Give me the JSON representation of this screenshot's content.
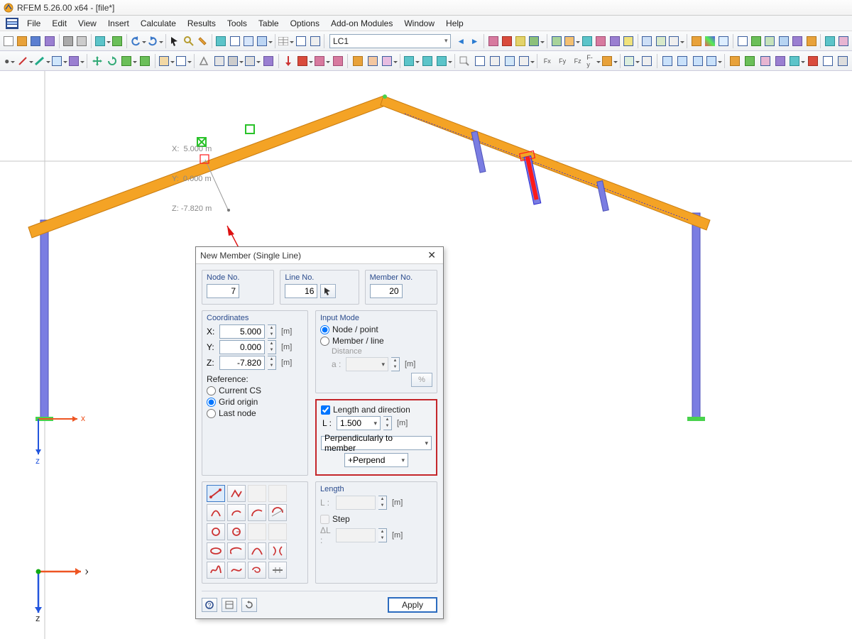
{
  "title": "RFEM 5.26.00 x64 - [file*]",
  "menus": [
    "File",
    "Edit",
    "View",
    "Insert",
    "Calculate",
    "Results",
    "Tools",
    "Table",
    "Options",
    "Add-on Modules",
    "Window",
    "Help"
  ],
  "lc_combo": "LC1",
  "cursor_readout": {
    "x": "X:  5.000 m",
    "y": "Y:  0.000 m",
    "z": "Z: -7.820 m"
  },
  "dialog": {
    "title": "New Member (Single Line)",
    "node_no_label": "Node No.",
    "node_no": "7",
    "line_no_label": "Line No.",
    "line_no": "16",
    "member_no_label": "Member No.",
    "member_no": "20",
    "coords_label": "Coordinates",
    "x_label": "X:",
    "x_val": "5.000",
    "x_unit": "[m]",
    "y_label": "Y:",
    "y_val": "0.000",
    "y_unit": "[m]",
    "z_label": "Z:",
    "z_val": "-7.820",
    "z_unit": "[m]",
    "reference_label": "Reference:",
    "ref_current": "Current CS",
    "ref_grid": "Grid origin",
    "ref_last": "Last node",
    "input_mode_label": "Input Mode",
    "im_node": "Node / point",
    "im_member": "Member / line",
    "distance_label": "Distance",
    "a_label": "a :",
    "a_unit": "[m]",
    "pct": "%",
    "len_dir_label": "Length and direction",
    "L_label": "L :",
    "L_val": "1.500",
    "L_unit": "[m]",
    "perp_member": "Perpendicularly to member",
    "perp_plus": "+Perpend",
    "length_group": "Length",
    "L2_label": "L :",
    "L2_unit": "[m]",
    "step_label": "Step",
    "dL_label": "ΔL :",
    "dL_unit": "[m]",
    "apply": "Apply"
  },
  "axes": {
    "x": "x",
    "z": "z"
  }
}
